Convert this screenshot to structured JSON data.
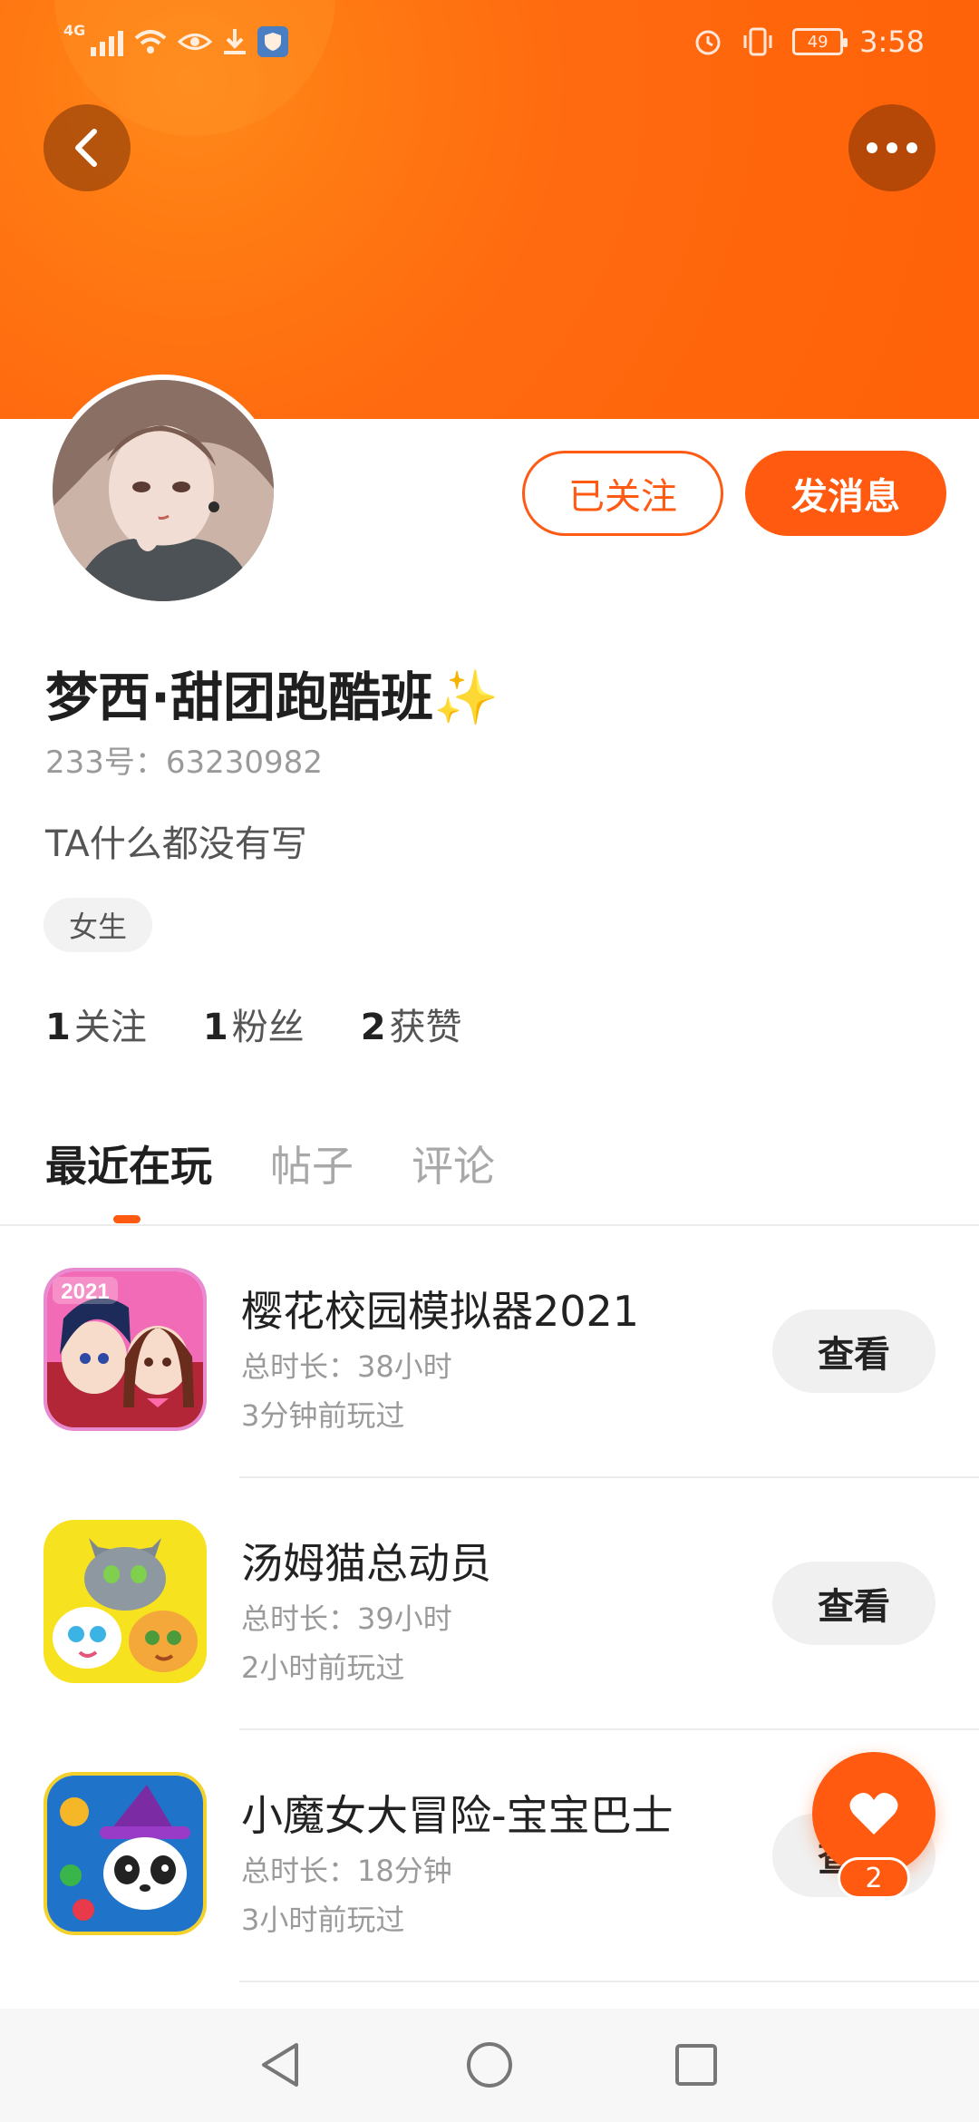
{
  "status_bar": {
    "network": "4G",
    "time": "3:58",
    "battery": "49"
  },
  "profile": {
    "username": "梦西·甜团跑酷班",
    "sparkle": "✨",
    "account_id": "233号：63230982",
    "bio": "TA什么都没有写",
    "gender_tag": "女生",
    "follow_label": "已关注",
    "message_label": "发消息",
    "stats": {
      "following_count": "1",
      "following_label": "关注",
      "fans_count": "1",
      "fans_label": "粉丝",
      "likes_count": "2",
      "likes_label": "获赞"
    }
  },
  "tabs": [
    {
      "label": "最近在玩",
      "active": true
    },
    {
      "label": "帖子",
      "active": false
    },
    {
      "label": "评论",
      "active": false
    }
  ],
  "games": [
    {
      "name": "樱花校园模拟器2021",
      "total_time": "总时长：38小时",
      "last_played": "3分钟前玩过",
      "action": "查看",
      "icon_badge": "2021"
    },
    {
      "name": "汤姆猫总动员",
      "total_time": "总时长：39小时",
      "last_played": "2小时前玩过",
      "action": "查看"
    },
    {
      "name": "小魔女大冒险-宝宝巴士",
      "total_time": "总时长：18分钟",
      "last_played": "3小时前玩过",
      "action": "查看"
    }
  ],
  "like_fab": {
    "count": "2"
  },
  "colors": {
    "accent": "#ff5a0f",
    "header_start": "#ff8a1c",
    "header_end": "#ff6208"
  }
}
